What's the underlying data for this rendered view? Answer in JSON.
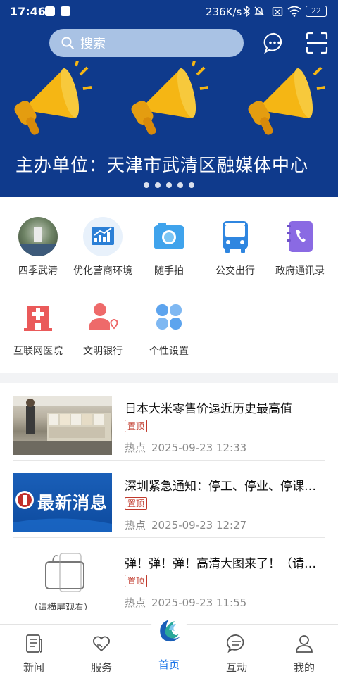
{
  "status_bar": {
    "time": "17:46",
    "network_speed": "236K/s",
    "battery": "22"
  },
  "search": {
    "placeholder": "搜索"
  },
  "banner": {
    "caption": "主办单位：天津市武清区融媒体中心",
    "slide_count": 5,
    "active_slide": 0
  },
  "services": [
    {
      "label": "四季武清",
      "icon": "photo-thumbnail-icon"
    },
    {
      "label": "优化营商环境",
      "icon": "chart-icon"
    },
    {
      "label": "随手拍",
      "icon": "camera-icon"
    },
    {
      "label": "公交出行",
      "icon": "bus-icon"
    },
    {
      "label": "政府通讯录",
      "icon": "phone-book-icon"
    },
    {
      "label": "互联网医院",
      "icon": "hospital-icon"
    },
    {
      "label": "文明银行",
      "icon": "user-heart-icon"
    },
    {
      "label": "个性设置",
      "icon": "clover-icon"
    }
  ],
  "news": [
    {
      "title": "日本大米零售价逼近历史最高值",
      "tag": "置顶",
      "category": "热点",
      "time": "2025-09-23 12:33",
      "thumb": "supermarket-rice-photo"
    },
    {
      "title": "深圳紧急通知：停工、停业、停课、停运、停市",
      "tag": "置顶",
      "category": "热点",
      "time": "2025-09-23 12:27",
      "thumb": "latest-news-banner",
      "thumb_text": "最新消息"
    },
    {
      "title": "弹！弹！弹！高清大图来了！（请横屏观看）",
      "tag": "置顶",
      "category": "热点",
      "time": "2025-09-23 11:55",
      "thumb": "rotate-phone-illustration",
      "thumb_text": "（请横屏观看）"
    }
  ],
  "tabbar": [
    {
      "label": "新闻",
      "icon": "newspaper-icon",
      "active": false
    },
    {
      "label": "服务",
      "icon": "heart-hand-icon",
      "active": false
    },
    {
      "label": "首页",
      "icon": "home-logo-icon",
      "active": true
    },
    {
      "label": "互动",
      "icon": "chat-bubble-icon",
      "active": false
    },
    {
      "label": "我的",
      "icon": "person-icon",
      "active": false
    }
  ],
  "colors": {
    "banner_bg": "#0f3a8c",
    "accent": "#1a73e8",
    "tag_red": "#c0392b"
  }
}
